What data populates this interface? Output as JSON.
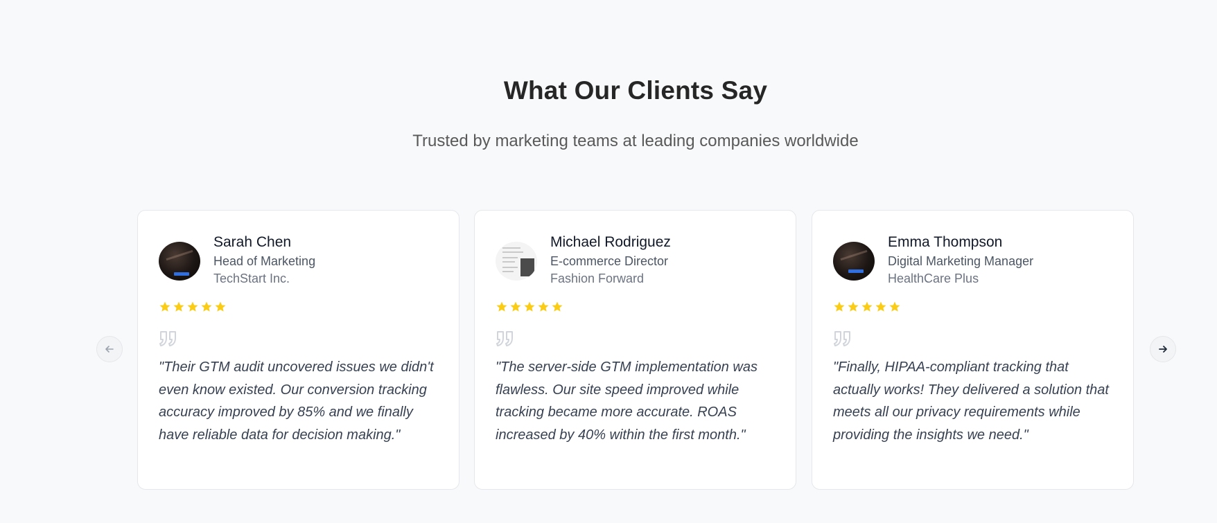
{
  "header": {
    "title": "What Our Clients Say",
    "subtitle": "Trusted by marketing teams at leading companies worldwide"
  },
  "carousel": {
    "prev_icon": "arrow-left-icon",
    "next_icon": "arrow-right-icon"
  },
  "colors": {
    "star": "#facc15",
    "quote_icon": "#d1d5db",
    "background": "#f8f9fb"
  },
  "testimonials": [
    {
      "name": "Sarah Chen",
      "role": "Head of Marketing",
      "company": "TechStart Inc.",
      "rating": 5,
      "quote": "\"Their GTM audit uncovered issues we didn't even know existed. Our conversion tracking accuracy improved by 85% and we finally have reliable data for decision making.\""
    },
    {
      "name": "Michael Rodriguez",
      "role": "E-commerce Director",
      "company": "Fashion Forward",
      "rating": 5,
      "quote": "\"The server-side GTM implementation was flawless. Our site speed improved while tracking became more accurate. ROAS increased by 40% within the first month.\""
    },
    {
      "name": "Emma Thompson",
      "role": "Digital Marketing Manager",
      "company": "HealthCare Plus",
      "rating": 5,
      "quote": "\"Finally, HIPAA-compliant tracking that actually works! They delivered a solution that meets all our privacy requirements while providing the insights we need.\""
    }
  ]
}
